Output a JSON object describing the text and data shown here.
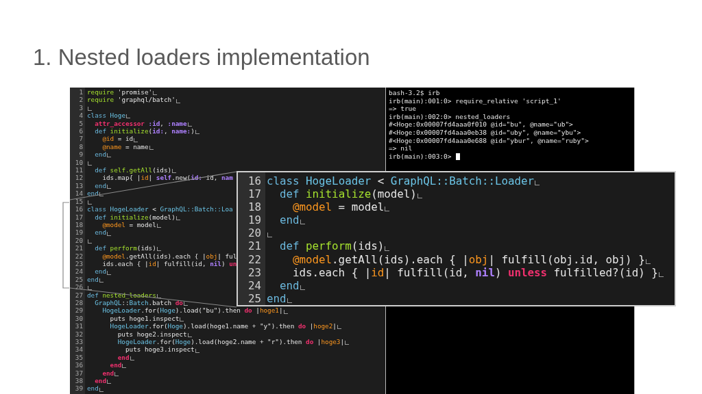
{
  "slide": {
    "title": "1. Nested loaders implementation"
  },
  "editor": {
    "lines": [
      {
        "no": "1",
        "eol": true,
        "tokens": [
          {
            "kind": "req",
            "text": "require"
          },
          {
            "kind": "p",
            "text": " 'promise'"
          }
        ]
      },
      {
        "no": "2",
        "eol": true,
        "tokens": [
          {
            "kind": "req",
            "text": "require"
          },
          {
            "kind": "p",
            "text": " 'graphql/batch'"
          }
        ]
      },
      {
        "no": "3",
        "eol": true
      },
      {
        "no": "4",
        "eol": true,
        "tokens": [
          {
            "kind": "kw",
            "text": "class"
          },
          {
            "kind": "const",
            "text": " Hoge"
          }
        ]
      },
      {
        "no": "5",
        "eol": true,
        "tokens": [
          {
            "kind": "red",
            "text": "  attr_accessor"
          },
          {
            "kind": "pur",
            "text": " :id"
          },
          {
            "kind": "p",
            "text": ", "
          },
          {
            "kind": "pur",
            "text": ":name"
          }
        ]
      },
      {
        "no": "6",
        "eol": true,
        "tokens": [
          {
            "kind": "kw",
            "text": "  def"
          },
          {
            "kind": "fn",
            "text": " initialize"
          },
          {
            "kind": "p",
            "text": "("
          },
          {
            "kind": "pur",
            "text": "id:"
          },
          {
            "kind": "p",
            "text": ", "
          },
          {
            "kind": "pur",
            "text": "name:"
          },
          {
            "kind": "p",
            "text": ")"
          }
        ]
      },
      {
        "no": "7",
        "eol": true,
        "tokens": [
          {
            "kind": "ivar",
            "text": "    @id"
          },
          {
            "kind": "p",
            "text": " = id"
          }
        ]
      },
      {
        "no": "8",
        "eol": true,
        "tokens": [
          {
            "kind": "ivar",
            "text": "    @name"
          },
          {
            "kind": "p",
            "text": " = name"
          }
        ]
      },
      {
        "no": "9",
        "eol": true,
        "tokens": [
          {
            "kind": "kw",
            "text": "  end"
          }
        ]
      },
      {
        "no": "10",
        "eol": true
      },
      {
        "no": "11",
        "eol": true,
        "tokens": [
          {
            "kind": "kw",
            "text": "  def"
          },
          {
            "kind": "fn",
            "text": " self.getAll"
          },
          {
            "kind": "p",
            "text": "(ids)"
          }
        ]
      },
      {
        "no": "12",
        "eol": false,
        "tokens": [
          {
            "kind": "p",
            "text": "    ids.map{ |"
          },
          {
            "kind": "ivar",
            "text": "id"
          },
          {
            "kind": "p",
            "text": "| "
          },
          {
            "kind": "pur",
            "text": "self"
          },
          {
            "kind": "p",
            "text": ".new("
          },
          {
            "kind": "pur",
            "text": "id:"
          },
          {
            "kind": "p",
            "text": " id, "
          },
          {
            "kind": "pur",
            "text": "nam"
          }
        ]
      },
      {
        "no": "13",
        "eol": true,
        "tokens": [
          {
            "kind": "kw",
            "text": "  end"
          }
        ]
      },
      {
        "no": "14",
        "eol": true,
        "tokens": [
          {
            "kind": "kw",
            "text": "end"
          }
        ]
      },
      {
        "no": "15",
        "eol": true
      },
      {
        "no": "16",
        "eol": false,
        "tokens": [
          {
            "kind": "kw",
            "text": "class"
          },
          {
            "kind": "const",
            "text": " HogeLoader"
          },
          {
            "kind": "p",
            "text": " < "
          },
          {
            "kind": "const",
            "text": "GraphQL::Batch::Loa"
          }
        ]
      },
      {
        "no": "17",
        "eol": true,
        "tokens": [
          {
            "kind": "kw",
            "text": "  def"
          },
          {
            "kind": "fn",
            "text": " initialize"
          },
          {
            "kind": "p",
            "text": "(model)"
          }
        ]
      },
      {
        "no": "18",
        "eol": true,
        "tokens": [
          {
            "kind": "ivar",
            "text": "    @model"
          },
          {
            "kind": "p",
            "text": " = model"
          }
        ]
      },
      {
        "no": "19",
        "eol": true,
        "tokens": [
          {
            "kind": "kw",
            "text": "  end"
          }
        ]
      },
      {
        "no": "20",
        "eol": true
      },
      {
        "no": "21",
        "eol": true,
        "tokens": [
          {
            "kind": "kw",
            "text": "  def"
          },
          {
            "kind": "fn",
            "text": " perform"
          },
          {
            "kind": "p",
            "text": "(ids)"
          }
        ]
      },
      {
        "no": "22",
        "eol": false,
        "tokens": [
          {
            "kind": "ivar",
            "text": "    @model"
          },
          {
            "kind": "p",
            "text": ".getAll(ids).each { |"
          },
          {
            "kind": "ivar",
            "text": "obj"
          },
          {
            "kind": "p",
            "text": "| ful"
          }
        ]
      },
      {
        "no": "23",
        "eol": false,
        "tokens": [
          {
            "kind": "p",
            "text": "    ids.each { |"
          },
          {
            "kind": "ivar",
            "text": "id"
          },
          {
            "kind": "p",
            "text": "| fulfill(id, "
          },
          {
            "kind": "pur",
            "text": "nil"
          },
          {
            "kind": "p",
            "text": ") "
          },
          {
            "kind": "red",
            "text": "un"
          }
        ]
      },
      {
        "no": "24",
        "eol": true,
        "tokens": [
          {
            "kind": "kw",
            "text": "  end"
          }
        ]
      },
      {
        "no": "25",
        "eol": true,
        "tokens": [
          {
            "kind": "kw",
            "text": "end"
          }
        ]
      },
      {
        "no": "26",
        "eol": true
      },
      {
        "no": "27",
        "eol": true,
        "tokens": [
          {
            "kind": "kw",
            "text": "def"
          },
          {
            "kind": "fn",
            "text": " nested_loaders"
          }
        ]
      },
      {
        "no": "28",
        "eol": true,
        "tokens": [
          {
            "kind": "const",
            "text": "  GraphQL"
          },
          {
            "kind": "p",
            "text": "::"
          },
          {
            "kind": "const",
            "text": "Batch"
          },
          {
            "kind": "p",
            "text": ".batch "
          },
          {
            "kind": "red",
            "text": "do"
          }
        ]
      },
      {
        "no": "29",
        "eol": true,
        "tokens": [
          {
            "kind": "const",
            "text": "    HogeLoader"
          },
          {
            "kind": "p",
            "text": ".for("
          },
          {
            "kind": "const",
            "text": "Hoge"
          },
          {
            "kind": "p",
            "text": ").load(\"bu\").then "
          },
          {
            "kind": "red",
            "text": "do"
          },
          {
            "kind": "p",
            "text": " |"
          },
          {
            "kind": "ivar",
            "text": "hoge1"
          },
          {
            "kind": "p",
            "text": "|"
          }
        ]
      },
      {
        "no": "30",
        "eol": true,
        "tokens": [
          {
            "kind": "p",
            "text": "      puts hoge1.inspect"
          }
        ]
      },
      {
        "no": "31",
        "eol": true,
        "tokens": [
          {
            "kind": "const",
            "text": "      HogeLoader"
          },
          {
            "kind": "p",
            "text": ".for("
          },
          {
            "kind": "const",
            "text": "Hoge"
          },
          {
            "kind": "p",
            "text": ").load(hoge1.name + \"y\").then "
          },
          {
            "kind": "red",
            "text": "do"
          },
          {
            "kind": "p",
            "text": " |"
          },
          {
            "kind": "ivar",
            "text": "hoge2"
          },
          {
            "kind": "p",
            "text": "|"
          }
        ]
      },
      {
        "no": "32",
        "eol": true,
        "tokens": [
          {
            "kind": "p",
            "text": "        puts hoge2.inspect"
          }
        ]
      },
      {
        "no": "33",
        "eol": true,
        "tokens": [
          {
            "kind": "const",
            "text": "        HogeLoader"
          },
          {
            "kind": "p",
            "text": ".for("
          },
          {
            "kind": "const",
            "text": "Hoge"
          },
          {
            "kind": "p",
            "text": ").load(hoge2.name + \"r\").then "
          },
          {
            "kind": "red",
            "text": "do"
          },
          {
            "kind": "p",
            "text": " |"
          },
          {
            "kind": "ivar",
            "text": "hoge3"
          },
          {
            "kind": "p",
            "text": "|"
          }
        ]
      },
      {
        "no": "34",
        "eol": true,
        "tokens": [
          {
            "kind": "p",
            "text": "          puts hoge3.inspect"
          }
        ]
      },
      {
        "no": "35",
        "eol": true,
        "tokens": [
          {
            "kind": "red",
            "text": "        end"
          }
        ]
      },
      {
        "no": "36",
        "eol": true,
        "tokens": [
          {
            "kind": "red",
            "text": "      end"
          }
        ]
      },
      {
        "no": "37",
        "eol": true,
        "tokens": [
          {
            "kind": "red",
            "text": "    end"
          }
        ]
      },
      {
        "no": "38",
        "eol": true,
        "tokens": [
          {
            "kind": "red",
            "text": "  end"
          }
        ]
      },
      {
        "no": "39",
        "eol": true,
        "tokens": [
          {
            "kind": "kw",
            "text": "end"
          }
        ]
      }
    ]
  },
  "terminal": {
    "cursor": true,
    "lines": [
      "bash-3.2$ irb",
      "irb(main):001:0> require_relative 'script_1'",
      "=> true",
      "irb(main):002:0> nested_loaders",
      "#<Hoge:0x00007fd4aaa0f010 @id=\"bu\", @name=\"ub\">",
      "#<Hoge:0x00007fd4aaa0eb38 @id=\"uby\", @name=\"ybu\">",
      "#<Hoge:0x00007fd4aaa0e688 @id=\"ybur\", @name=\"ruby\">",
      "=> nil",
      "irb(main):003:0>"
    ]
  },
  "zoom": {
    "lines": [
      {
        "no": "16",
        "eol": true,
        "tokens": [
          {
            "kind": "kw",
            "text": "class"
          },
          {
            "kind": "const",
            "text": " HogeLoader"
          },
          {
            "kind": "p",
            "text": " < "
          },
          {
            "kind": "const",
            "text": "GraphQL::Batch::Loader"
          }
        ]
      },
      {
        "no": "17",
        "eol": true,
        "tokens": [
          {
            "kind": "kw",
            "text": "  def"
          },
          {
            "kind": "fn",
            "text": " initialize"
          },
          {
            "kind": "p",
            "text": "(model)"
          }
        ]
      },
      {
        "no": "18",
        "eol": true,
        "tokens": [
          {
            "kind": "ivar",
            "text": "    @model"
          },
          {
            "kind": "p",
            "text": " = model"
          }
        ]
      },
      {
        "no": "19",
        "eol": true,
        "tokens": [
          {
            "kind": "kw",
            "text": "  end"
          }
        ]
      },
      {
        "no": "20",
        "eol": true
      },
      {
        "no": "21",
        "eol": true,
        "tokens": [
          {
            "kind": "kw",
            "text": "  def"
          },
          {
            "kind": "fn",
            "text": " perform"
          },
          {
            "kind": "p",
            "text": "(ids)"
          }
        ]
      },
      {
        "no": "22",
        "eol": true,
        "tokens": [
          {
            "kind": "ivar",
            "text": "    @model"
          },
          {
            "kind": "p",
            "text": ".getAll(ids).each { |"
          },
          {
            "kind": "ivar",
            "text": "obj"
          },
          {
            "kind": "p",
            "text": "| fulfill(obj.id, obj) }"
          }
        ]
      },
      {
        "no": "23",
        "eol": true,
        "tokens": [
          {
            "kind": "p",
            "text": "    ids.each { |"
          },
          {
            "kind": "ivar",
            "text": "id"
          },
          {
            "kind": "p",
            "text": "| fulfill(id, "
          },
          {
            "kind": "pur",
            "text": "nil"
          },
          {
            "kind": "p",
            "text": ") "
          },
          {
            "kind": "red",
            "text": "unless"
          },
          {
            "kind": "p",
            "text": " fulfilled?(id) }"
          }
        ]
      },
      {
        "no": "24",
        "eol": true,
        "tokens": [
          {
            "kind": "kw",
            "text": "  end"
          }
        ]
      },
      {
        "no": "25",
        "eol": true,
        "tokens": [
          {
            "kind": "kw",
            "text": "end"
          }
        ]
      }
    ]
  }
}
